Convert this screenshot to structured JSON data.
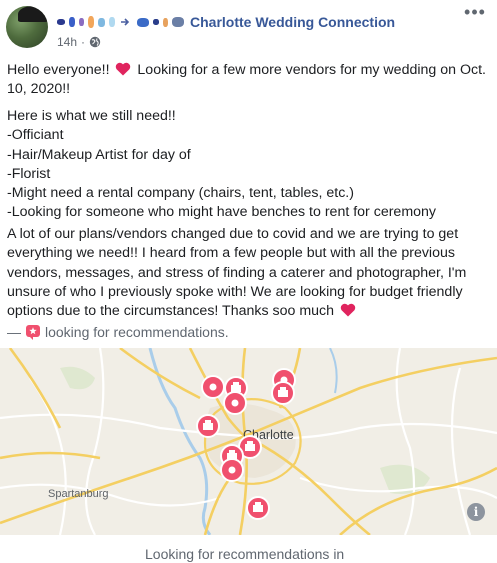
{
  "header": {
    "group_name": "Charlotte Wedding Connection",
    "timestamp": "14h",
    "privacy_icon": "globe-icon",
    "more_icon": "more-options-icon"
  },
  "post": {
    "paragraph1_before_heart": "Hello everyone!! ",
    "paragraph1_after_heart": " Looking for a few more vendors for my wedding on Oct. 10, 2020!!",
    "needs_heading": "Here is what we still need!!",
    "needs": [
      "-Officiant",
      "-Hair/Makeup Artist for day of",
      "-Florist",
      "-Might need a rental company (chairs, tent, tables, etc.)",
      "-Looking for someone who might have benches to rent for ceremony"
    ],
    "paragraph3": "A lot of our plans/vendors changed due to covid and we are trying to get everything we need!! I heard from a few people but with all the previous vendors, messages, and stress of finding a caterer and photographer, I'm unsure of who I previously spoke with! We are looking for budget friendly options due to the circumstances! Thanks soo much ",
    "recommendation_prefix": "—",
    "recommendation_text": "looking for recommendations."
  },
  "map": {
    "city_label": "Charlotte",
    "town_label": "Spartanburg",
    "pin_color": "#f0506e"
  },
  "footer": {
    "text": "Looking for recommendations in"
  },
  "colors": {
    "link": "#385898",
    "heart": "#e0245e",
    "secondary": "#606770"
  }
}
